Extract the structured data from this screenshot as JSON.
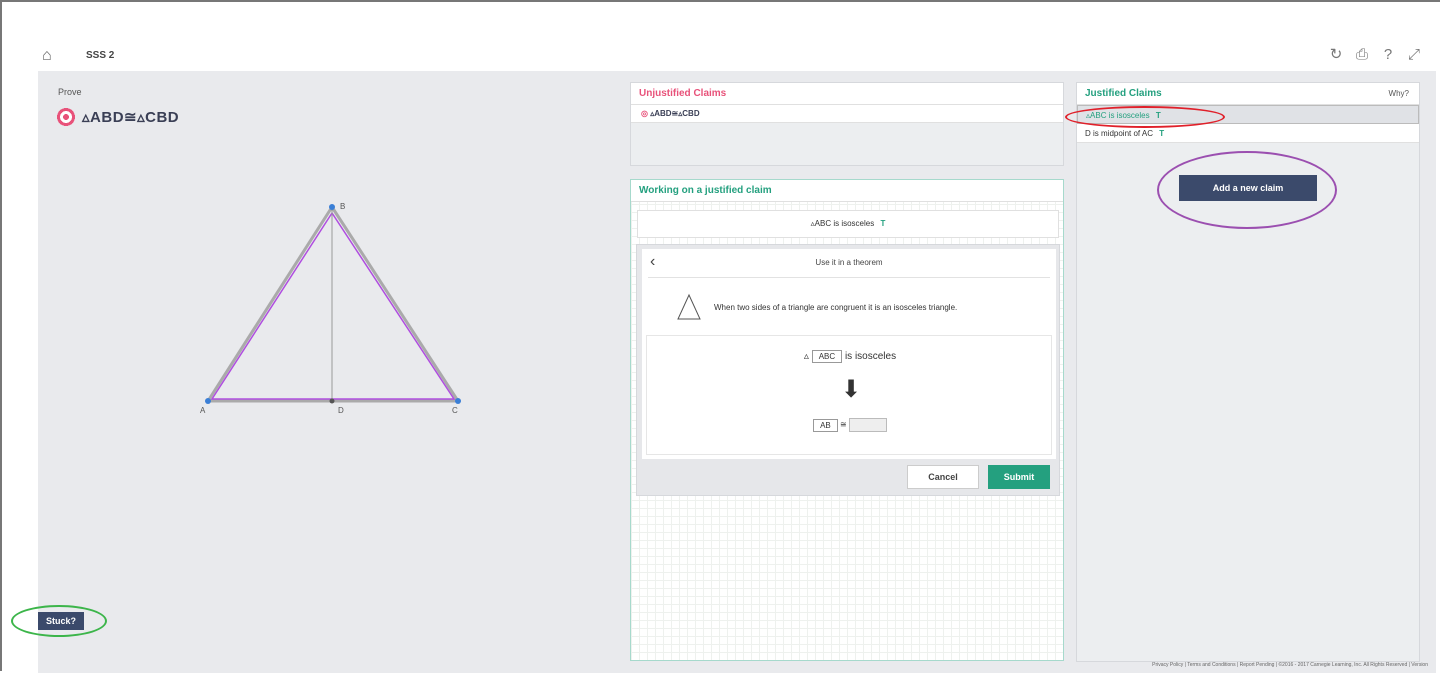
{
  "topbar": {
    "title": "SSS 2",
    "home_icon": "home-icon",
    "reset_icon": "refresh-icon",
    "print_icon": "print-icon",
    "help_icon": "help-icon",
    "fullscreen_icon": "fullscreen-icon"
  },
  "prove": {
    "label": "Prove",
    "goal": "▵ABD≅▵CBD",
    "goal_icon": "target-icon"
  },
  "figure": {
    "points": [
      "B",
      "A",
      "D",
      "C"
    ],
    "triangle_color": "#b04ee0"
  },
  "stuck": {
    "label": "Stuck?"
  },
  "unjustified": {
    "title": "Unjustified Claims",
    "items": [
      {
        "text": "▵ABD≅▵CBD"
      }
    ]
  },
  "working": {
    "title": "Working on a justified claim",
    "claim": "▵ABC is isosceles",
    "theorem_title": "Use it in a theorem",
    "back_icon": "chevron-left-icon",
    "theorem_icon": "triangle-icon",
    "theorem_description": "When two sides of a triangle are congruent it is an isosceles triangle.",
    "premise_prefix": "▵",
    "premise_slot": "ABC",
    "premise_suffix": "is isosceles",
    "arrow_icon": "arrow-down-icon",
    "conclusion_slot": "AB",
    "conclusion_op": "≅",
    "cancel_label": "Cancel",
    "submit_label": "Submit"
  },
  "justified": {
    "title": "Justified Claims",
    "why_label": "Why?",
    "items": [
      {
        "text": "▵ABC is isosceles",
        "badge": "T"
      },
      {
        "text": "D is midpoint of AC",
        "badge": "T"
      }
    ],
    "add_claim_label": "Add a new claim"
  },
  "footer": {
    "text": "Privacy Policy | Terms and Conditions | Report Pending | ©2016 - 2017 Carnegie Learning, Inc. All Rights Reserved | Version"
  },
  "colors": {
    "accent_green": "#24a07f",
    "accent_pink": "#e8527a",
    "navy_button": "#3b4a6b",
    "annotation_red": "#e0202a",
    "annotation_purple": "#9b4fb0",
    "annotation_green": "#3cb54a"
  }
}
